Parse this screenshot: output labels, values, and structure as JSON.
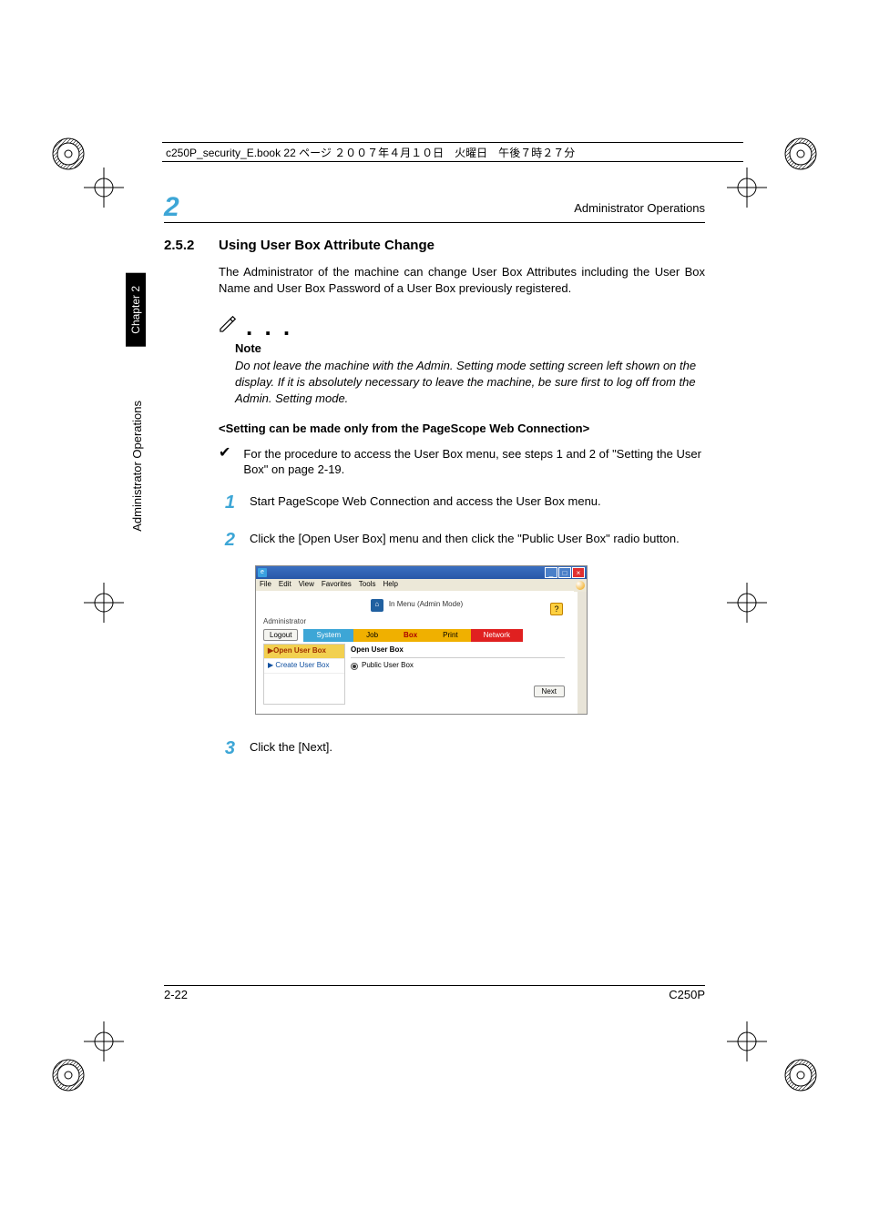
{
  "meta": {
    "header_line": "c250P_security_E.book  22 ページ  ２００７年４月１０日　火曜日　午後７時２７分"
  },
  "running": {
    "chapter_num": "2",
    "title": "Administrator Operations"
  },
  "sidetab": {
    "chapter": "Chapter 2",
    "section": "Administrator Operations"
  },
  "section": {
    "num": "2.5.2",
    "title": "Using User Box Attribute Change",
    "intro": "The Administrator of the machine can change User Box Attributes including the User Box Name and User Box Password of a User Box previously registered."
  },
  "note": {
    "label": "Note",
    "body": "Do not leave the machine with the Admin. Setting mode setting screen left shown on the display. If it is absolutely necessary to leave the machine, be sure first to log off from the Admin. Setting mode."
  },
  "subhead": "<Setting can be made only from the PageScope Web Connection>",
  "check": "For the procedure to access the User Box menu, see steps 1 and 2 of \"Setting the User Box\" on page 2-19.",
  "steps": {
    "s1_num": "1",
    "s1_text": "Start PageScope Web Connection and access the User Box menu.",
    "s2_num": "2",
    "s2_text": "Click the [Open User Box] menu and then click the \"Public User Box\" radio button.",
    "s3_num": "3",
    "s3_text": "Click the [Next]."
  },
  "screenshot": {
    "menubar": {
      "file": "File",
      "edit": "Edit",
      "view": "View",
      "favorites": "Favorites",
      "tools": "Tools",
      "help": "Help"
    },
    "logo_text": "In Menu (Admin Mode)",
    "admin": "Administrator",
    "logout": "Logout",
    "tabs": {
      "system": "System",
      "job": "Job",
      "box": "Box",
      "print": "Print",
      "network": "Network"
    },
    "nav": {
      "open": "▶Open User Box",
      "create": "▶ Create User Box"
    },
    "panel": {
      "head": "Open User Box",
      "radio_label": "Public User Box",
      "next": "Next"
    },
    "help_icon_text": "?"
  },
  "footer": {
    "page": "2-22",
    "model": "C250P"
  }
}
